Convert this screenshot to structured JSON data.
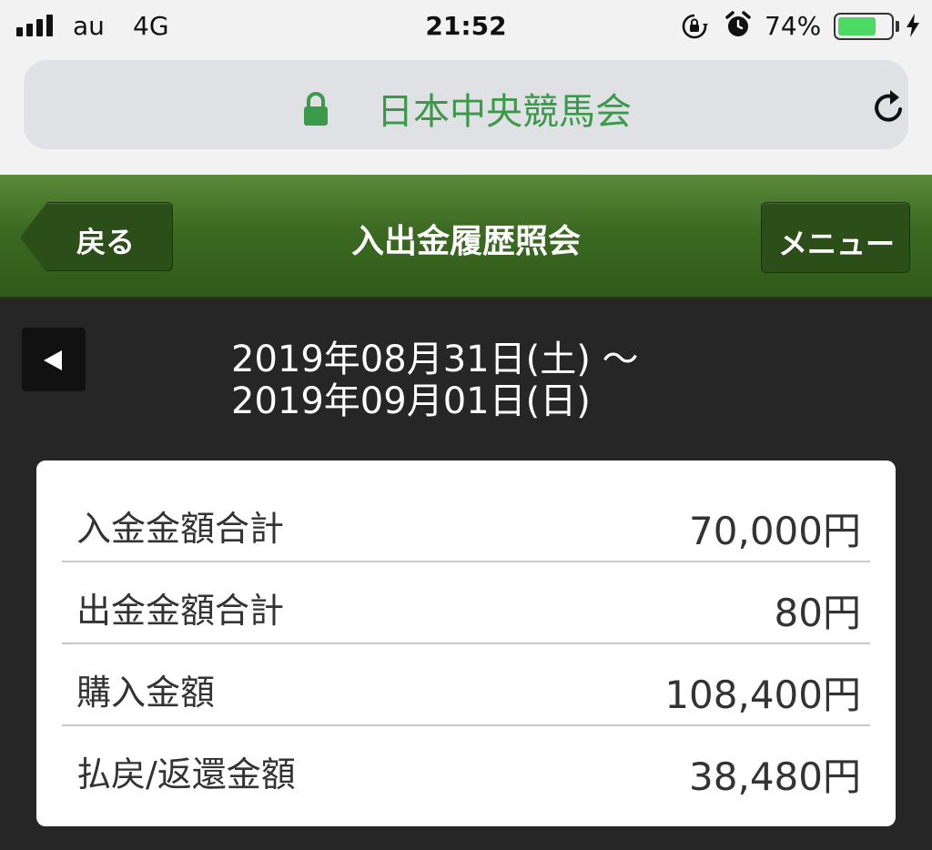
{
  "status_bar": {
    "carrier": "au",
    "network": "4G",
    "time": "21:52",
    "battery_percent": "74%",
    "battery_level": 0.74,
    "battery_color": "#4cd964"
  },
  "browser": {
    "site_title": "日本中央競馬会",
    "title_color": "#3a9a4a",
    "icons": [
      "lock-icon",
      "reload-icon"
    ]
  },
  "header": {
    "back_label": "戻る",
    "title": "入出金履歴照会",
    "menu_label": "メニュー",
    "theme_color": "#3c6a22"
  },
  "date_range": {
    "from": "2019年08月31日(土) 〜",
    "to": "2019年09月01日(日)"
  },
  "summary": {
    "rows": [
      {
        "label": "入金金額合計",
        "value": "70,000円"
      },
      {
        "label": "出金金額合計",
        "value": "80円"
      },
      {
        "label": "購入金額",
        "value": "108,400円"
      },
      {
        "label": "払戻/返還金額",
        "value": "38,480円"
      }
    ]
  }
}
